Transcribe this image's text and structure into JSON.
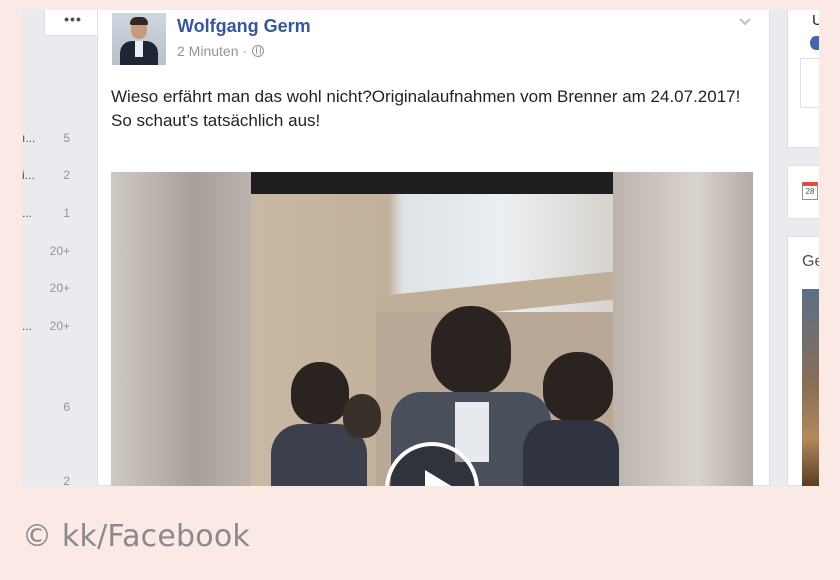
{
  "sidebar": {
    "more_label": "•••",
    "rows": [
      {
        "trunc": "ı...",
        "count": "5"
      },
      {
        "trunc": "i...",
        "count": "2"
      },
      {
        "trunc": "...",
        "count": "1"
      },
      {
        "trunc": "",
        "count": "20+"
      },
      {
        "trunc": "",
        "count": "20+"
      },
      {
        "trunc": "...",
        "count": "20+"
      },
      {
        "trunc": "",
        "count": "6"
      },
      {
        "trunc": "",
        "count": "2"
      }
    ]
  },
  "post": {
    "author": "Wolfgang Germ",
    "timestamp": "2 Minuten",
    "separator": "·",
    "privacy_icon": "globe-icon",
    "options_icon": "chevron-down-icon",
    "text_line1": "Wieso erfährt man das wohl nicht?Originalaufnahmen vom Brenner am 24.07.2017!",
    "text_line2": "So schaut's tatsächlich aus!",
    "video": {
      "play_icon": "play-icon"
    }
  },
  "right_column": {
    "card1_letter": "U",
    "calendar_day": "28",
    "card3_letters": "Ge"
  },
  "caption": "© kk/Facebook",
  "colors": {
    "page_background": "#fbe9e6",
    "facebook_background": "#e9ebee",
    "author_link": "#365899",
    "caption_text": "#8a8a8a"
  }
}
